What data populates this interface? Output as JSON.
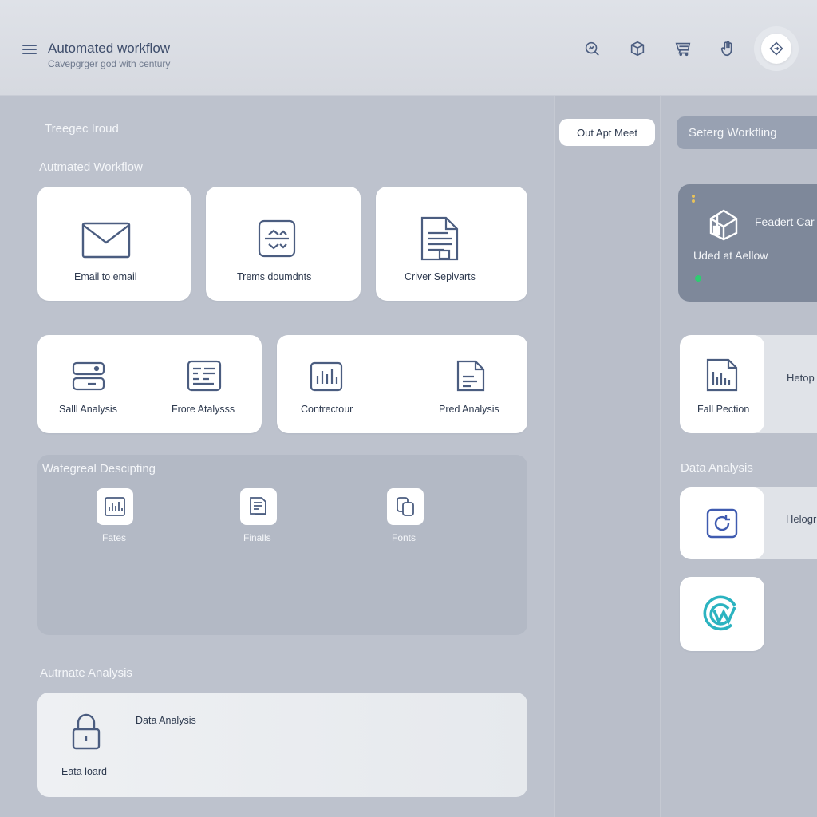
{
  "header": {
    "title": "Automated workflow",
    "subtitle": "Cavepgrger god with century",
    "icons": [
      "search-chart-icon",
      "cube-icon",
      "cart-icon",
      "hand-icon",
      "diamond-arrow-icon"
    ]
  },
  "left": {
    "top_label": "Treegec Iroud",
    "section1_label": "Autmated Workflow",
    "row1": [
      {
        "label": "Email to email",
        "icon": "envelope-icon"
      },
      {
        "label": "Trems doumdnts",
        "icon": "document-arrows-icon"
      },
      {
        "label": "Criver Seplvarts",
        "icon": "file-lines-icon"
      }
    ],
    "row2a": [
      {
        "label": "Salll Analysis",
        "icon": "server-icon"
      },
      {
        "label": "Frore Atalysss",
        "icon": "dashboard-icon"
      }
    ],
    "row2b": [
      {
        "label": "Contrectour",
        "icon": "bar-chart-icon"
      },
      {
        "label": "Pred Analysis",
        "icon": "file-icon"
      }
    ],
    "panel_label": "Wategreal Descipting",
    "panel_items": [
      {
        "label": "Fates",
        "icon": "chart-icon"
      },
      {
        "label": "Finalls",
        "icon": "docs-icon"
      },
      {
        "label": "Fonts",
        "icon": "copy-icon"
      }
    ],
    "section2_label": "Autrnate Analysis",
    "bottom_card": {
      "title": "Data Analysis",
      "sublabel": "Eata loard",
      "icon": "lock-icon"
    }
  },
  "mid": {
    "button_label": "Out Apt Meet"
  },
  "right": {
    "setting_label": "Seterg Workfling",
    "dark_card": {
      "title": "Feadert Car",
      "subtitle": "Uded at Aellow",
      "icon": "box-icon"
    },
    "card1": {
      "label": "Fall Pection",
      "side_text": "Hetop",
      "icon": "report-chart-icon"
    },
    "section_label": "Data Analysis",
    "card2": {
      "side_text": "Helogr",
      "icon": "refresh-icon"
    },
    "card3": {
      "icon": "teal-logo-icon"
    }
  },
  "colors": {
    "accent": "#4b5d80",
    "teal": "#2bb3c0",
    "status_green": "#2ecc71"
  }
}
